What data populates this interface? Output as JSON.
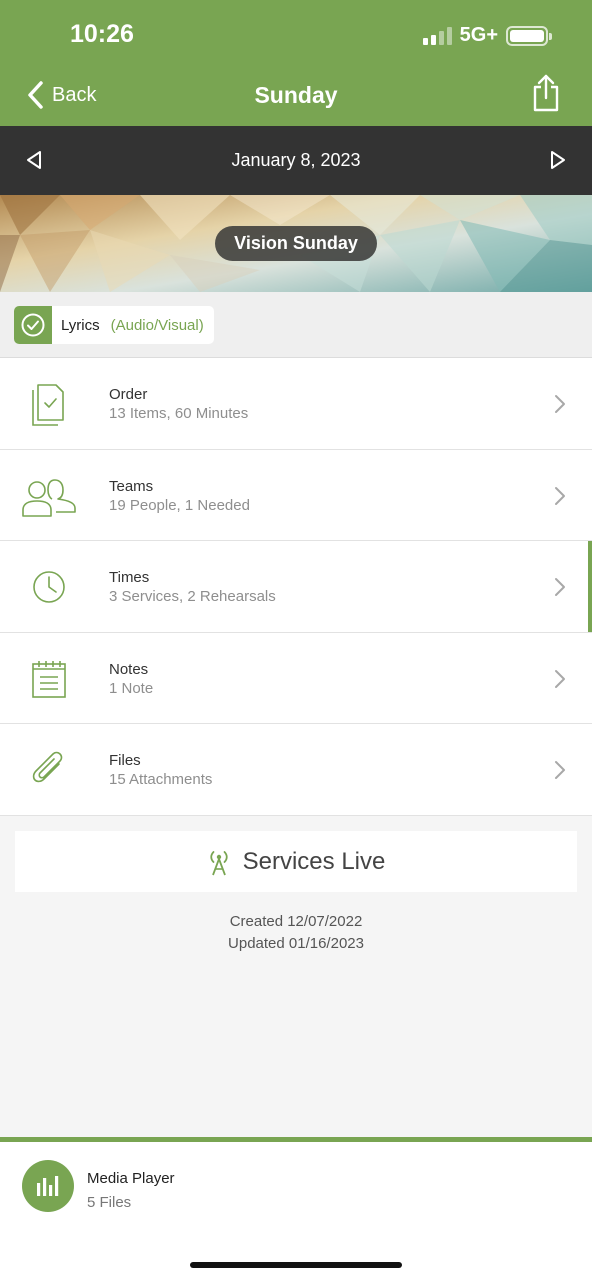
{
  "status_bar": {
    "time": "10:26",
    "network": "5G+"
  },
  "nav": {
    "back_label": "Back",
    "title": "Sunday",
    "back_icon": "chevron-left-icon",
    "share_icon": "share-icon"
  },
  "date_nav": {
    "date": "January 8, 2023",
    "prev_icon": "triangle-left-icon",
    "next_icon": "triangle-right-icon"
  },
  "banner": {
    "title": "Vision Sunday"
  },
  "tag": {
    "name": "Lyrics",
    "type": "(Audio/Visual)"
  },
  "rows": [
    {
      "title": "Order",
      "subtitle": "13 Items, 60 Minutes",
      "icon": "document-check-icon"
    },
    {
      "title": "Teams",
      "subtitle": "19 People, 1 Needed",
      "icon": "people-icon"
    },
    {
      "title": "Times",
      "subtitle": "3 Services, 2 Rehearsals",
      "icon": "clock-icon"
    },
    {
      "title": "Notes",
      "subtitle": "1 Note",
      "icon": "notepad-icon"
    },
    {
      "title": "Files",
      "subtitle": "15 Attachments",
      "icon": "paperclip-icon"
    }
  ],
  "services_live": {
    "label": "Services Live",
    "icon": "broadcast-tower-icon"
  },
  "meta": {
    "created": "Created 12/07/2022",
    "updated": "Updated 01/16/2023"
  },
  "media_player": {
    "title": "Media Player",
    "subtitle": "5 Files",
    "icon": "audio-bars-icon"
  },
  "colors": {
    "brand_green": "#79a552",
    "dark_bar": "#333333",
    "background": "#f5f5f5"
  }
}
